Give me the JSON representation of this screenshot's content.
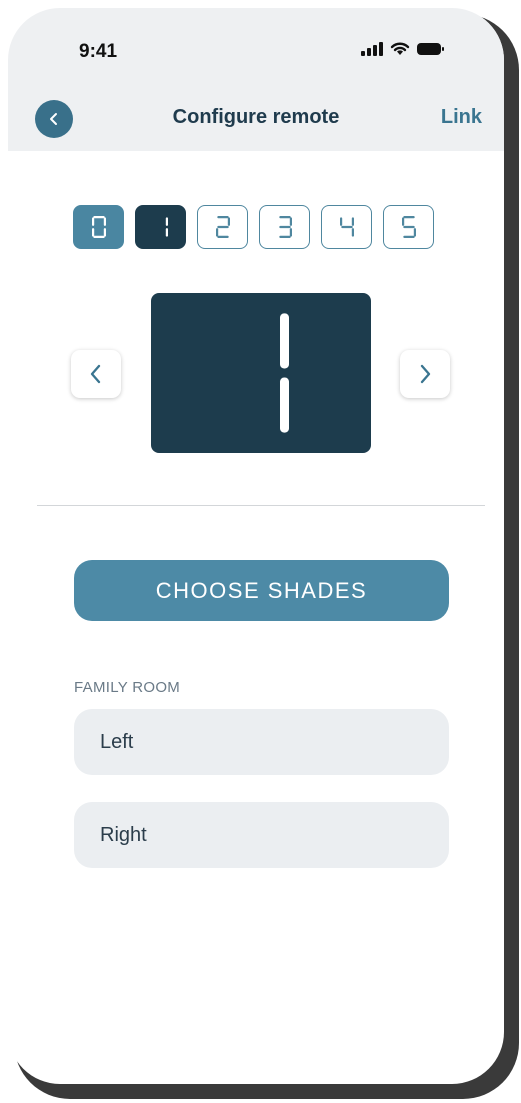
{
  "status": {
    "time": "9:41"
  },
  "header": {
    "title": "Configure remote",
    "link_label": "Link",
    "back_icon": "chevron-left-icon"
  },
  "digits": {
    "options": [
      "0",
      "1",
      "2",
      "3",
      "4",
      "5"
    ],
    "selected": "1",
    "display_value": "1"
  },
  "actions": {
    "choose_shades_label": "CHOOSE SHADES"
  },
  "room": {
    "name": "FAMILY ROOM",
    "shades": [
      "Left",
      "Right"
    ]
  },
  "colors": {
    "accent": "#4d8aa6",
    "dark": "#1d3c4d",
    "header_bg": "#eef0f2",
    "title_text": "#1f3b4d"
  }
}
